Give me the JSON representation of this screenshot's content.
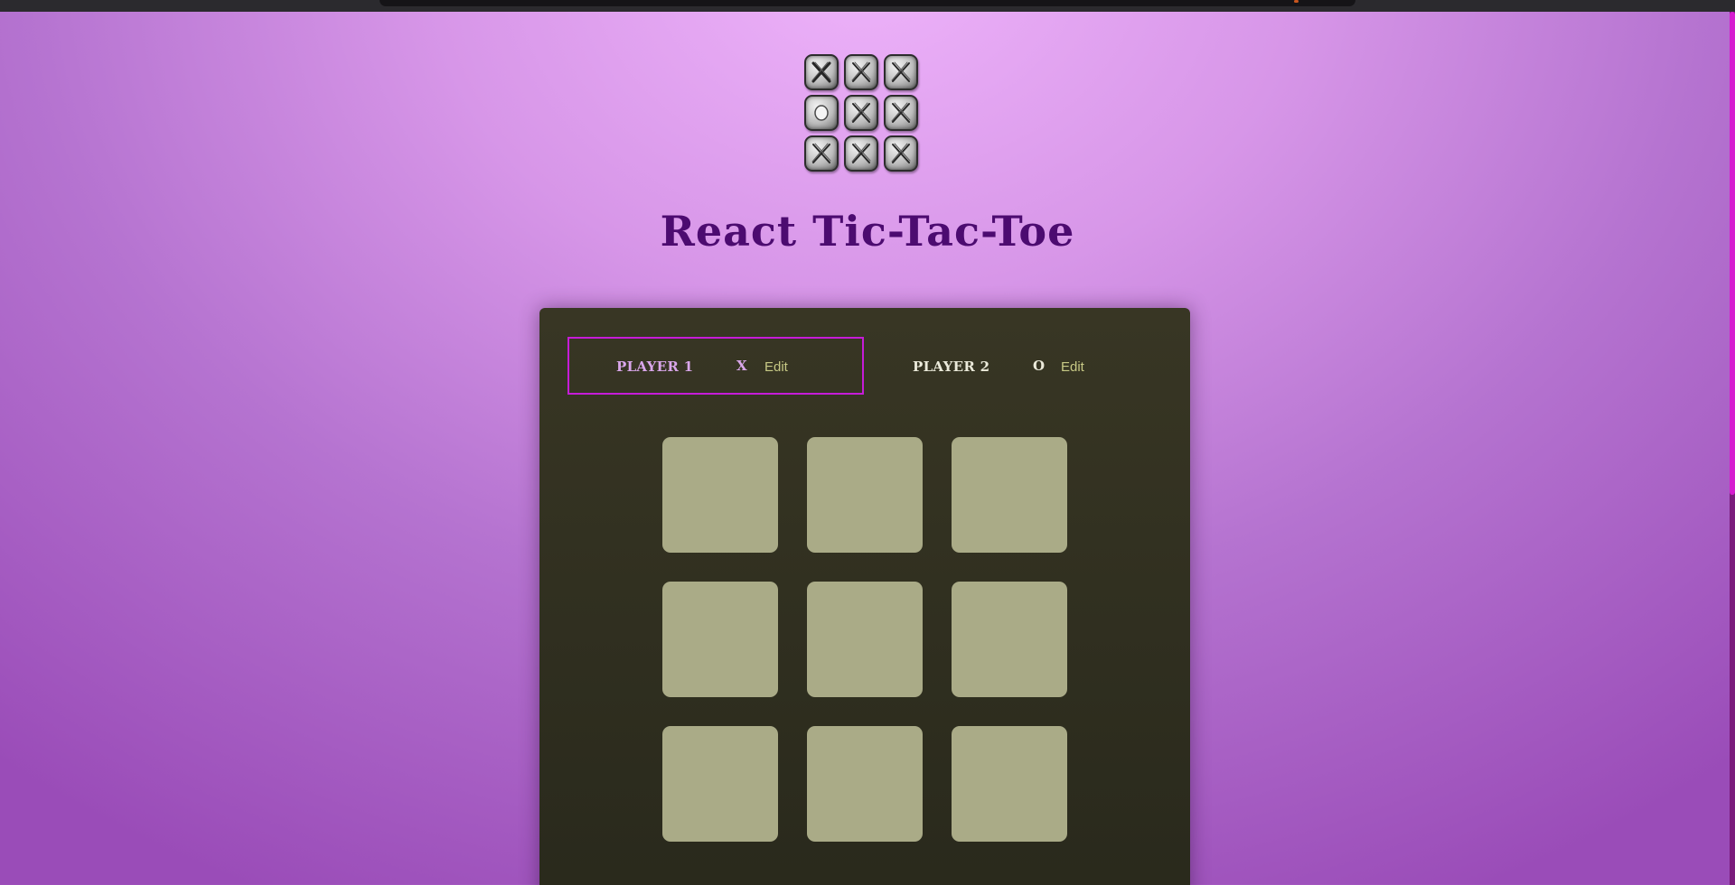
{
  "app": {
    "title": "React Tic-Tac-Toe",
    "logo_icon": "tic-tac-toe-board-icon"
  },
  "players": [
    {
      "name": "PLAYER 1",
      "symbol": "X",
      "edit_label": "Edit",
      "active": true
    },
    {
      "name": "PLAYER 2",
      "symbol": "O",
      "edit_label": "Edit",
      "active": false
    }
  ],
  "board": {
    "cells": [
      [
        "",
        "",
        ""
      ],
      [
        "",
        "",
        ""
      ],
      [
        "",
        "",
        ""
      ]
    ]
  },
  "colors": {
    "title": "#4c0b70",
    "active_player_border": "#c61cd8",
    "panel_background": "#2f2e1f",
    "cell_background": "#aaab87",
    "edit_link": "#c7c985"
  }
}
